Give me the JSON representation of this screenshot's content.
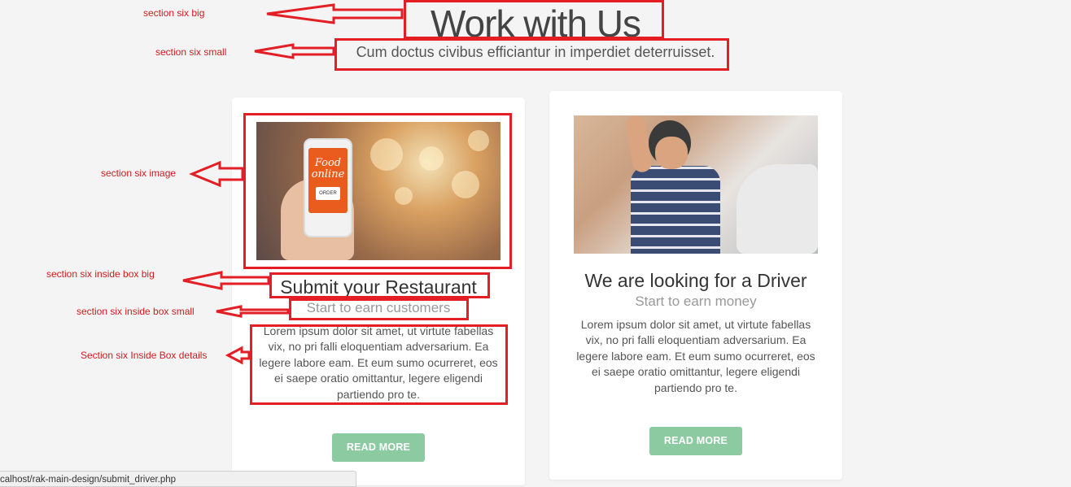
{
  "section": {
    "title": "Work with Us",
    "subtitle": "Cum doctus civibus efficiantur in imperdiet deterruisset."
  },
  "cards": [
    {
      "title": "Submit your Restaurant",
      "subtitle": "Start to earn customers",
      "body": "Lorem ipsum dolor sit amet, ut virtute fabellas vix, no pri falli eloquentiam adversarium. Ea legere labore eam. Et eum sumo ocurreret, eos ei saepe oratio omittantur, legere eligendi partiendo pro te.",
      "button": "READ MORE",
      "image_text": "Food online",
      "image_button": "ORDER"
    },
    {
      "title": "We are looking for a Driver",
      "subtitle": "Start to earn money",
      "body": "Lorem ipsum dolor sit amet, ut virtute fabellas vix, no pri falli eloquentiam adversarium. Ea legere labore eam. Et eum sumo ocurreret, eos ei saepe oratio omittantur, legere eligendi partiendo pro te.",
      "button": "READ MORE"
    }
  ],
  "annotations": {
    "big": "section six big",
    "small": "section six small",
    "image": "section six image",
    "inside_big": "section six inside box big",
    "inside_small": "section six inside box small",
    "inside_details": "Section six Inside Box details"
  },
  "status_url": "calhost/rak-main-design/submit_driver.php",
  "colors": {
    "accent_button": "#8ccba1",
    "annotation_red": "#e31e24",
    "background": "#f4f4f4"
  }
}
